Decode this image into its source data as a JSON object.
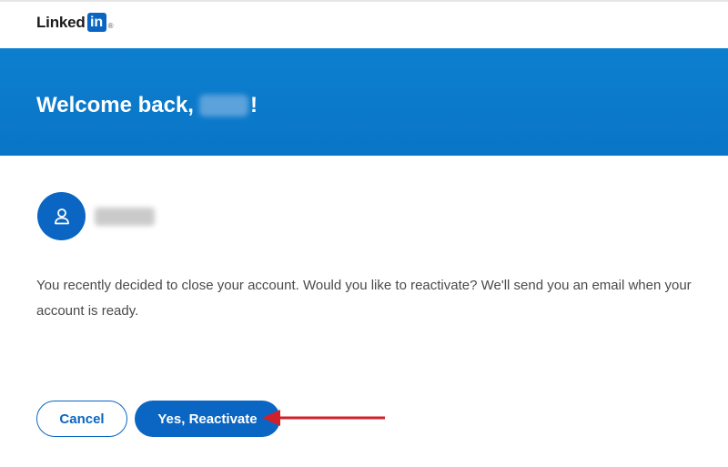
{
  "brand": {
    "wordmark": "Linked",
    "badge": "in",
    "registered": "®",
    "color": "#0a66c2"
  },
  "banner": {
    "greeting": "Welcome back,",
    "punctuation": "!",
    "background": "#0a75c7"
  },
  "account": {
    "avatar_icon": "person-outline-icon"
  },
  "message": {
    "text": "You recently decided to close your account. Would you like to reactivate? We'll send you an email when your account is ready."
  },
  "actions": {
    "cancel_label": "Cancel",
    "reactivate_label": "Yes, Reactivate"
  },
  "annotation": {
    "arrow_color": "#d0212a"
  }
}
